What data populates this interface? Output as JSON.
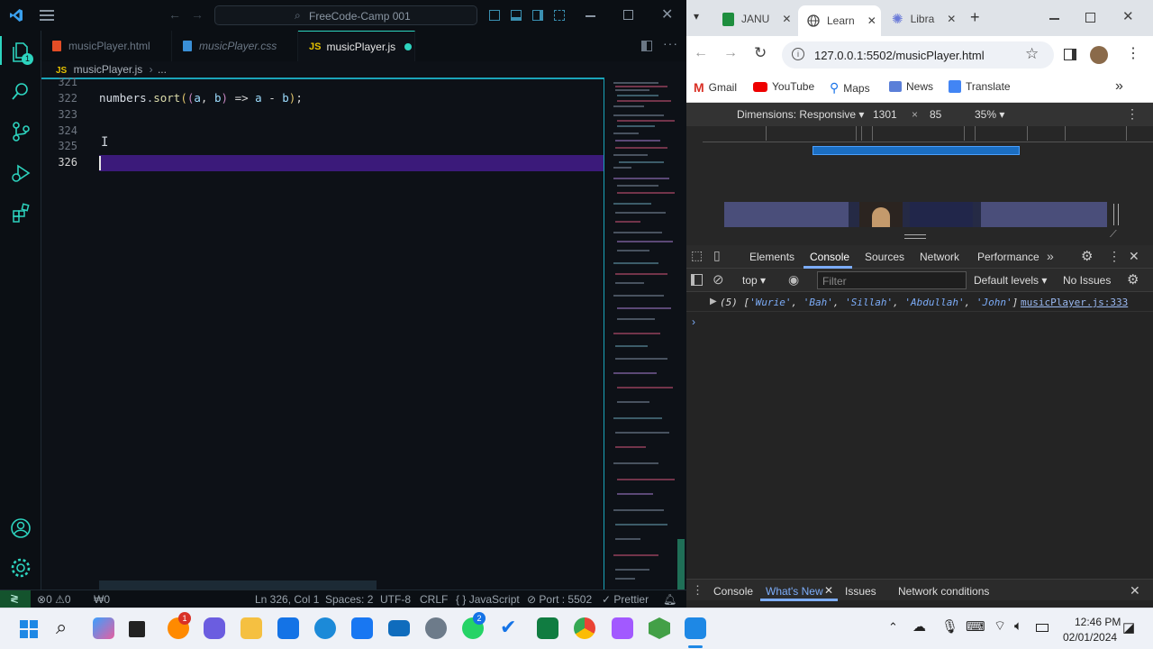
{
  "vscode": {
    "search_text": "FreeCode-Camp 001",
    "tabs": [
      {
        "label": "musicPlayer.html",
        "icon": "html-icon"
      },
      {
        "label": "musicPlayer.css",
        "icon": "css-icon"
      },
      {
        "label": "musicPlayer.js",
        "icon": "js-icon"
      }
    ],
    "breadcrumb_file": "musicPlayer.js",
    "breadcrumb_rest": "...",
    "js_badge": "JS",
    "lines": [
      {
        "num": "321",
        "code": ""
      },
      {
        "num": "322",
        "code": "numbers.sort((a, b) => a - b);"
      },
      {
        "num": "323",
        "code": ""
      },
      {
        "num": "324",
        "code": ""
      },
      {
        "num": "325",
        "code": ""
      },
      {
        "num": "326",
        "code": ""
      }
    ],
    "status": {
      "errors": "0",
      "warnings": "0",
      "ports": "0",
      "position": "Ln 326, Col 1",
      "spaces": "Spaces: 2",
      "encoding": "UTF-8",
      "eol": "CRLF",
      "language": "JavaScript",
      "port": "Port : 5502",
      "prettier": "Prettier"
    },
    "explorer_badge": "1"
  },
  "chrome": {
    "tabs": [
      {
        "label": "JANU",
        "icon": "sheets-icon"
      },
      {
        "label": "Learn",
        "icon": "globe-icon"
      },
      {
        "label": "Libra",
        "icon": "library-icon"
      }
    ],
    "url": "127.0.0.1:5502/musicPlayer.html",
    "bookmarks": [
      "Gmail",
      "YouTube",
      "Maps",
      "News",
      "Translate"
    ],
    "device": {
      "dimensions": "Dimensions: Responsive",
      "width": "1301",
      "times": "×",
      "height": "85",
      "zoom": "35%"
    },
    "devtools": {
      "tabs": [
        "Elements",
        "Console",
        "Sources",
        "Network",
        "Performance"
      ],
      "context": "top",
      "filter_placeholder": "Filter",
      "levels": "Default levels",
      "issues": "No Issues",
      "log_prefix": "(5)",
      "log_array": [
        "'Wurie'",
        "'Bah'",
        "'Sillah'",
        "'Abdullah'",
        "'John'"
      ],
      "log_source": "musicPlayer.js:333",
      "drawer_tabs": [
        "Console",
        "What's New",
        "Issues",
        "Network conditions"
      ]
    }
  },
  "taskbar": {
    "time": "12:46 PM",
    "date": "02/01/2024",
    "badge_1": "1",
    "badge_2": "2"
  },
  "colors": {
    "accent_teal": "#2dd4bf",
    "line_highlight": "#3b1a7a",
    "devtools_blue": "#7cacf8"
  }
}
